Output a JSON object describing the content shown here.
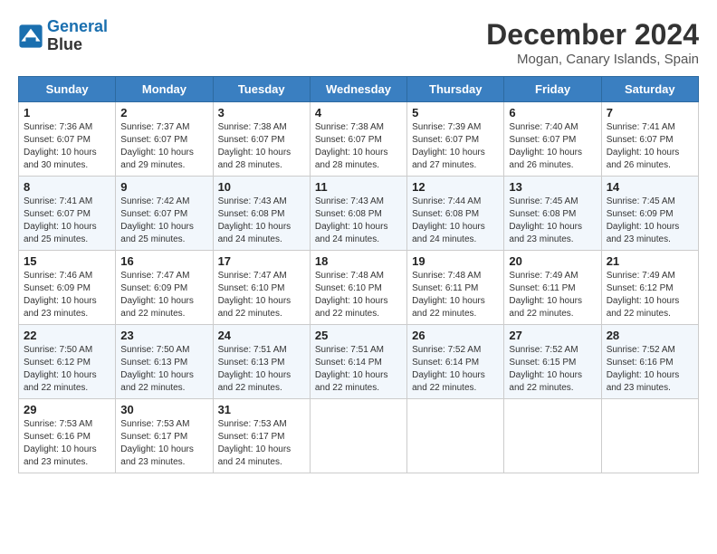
{
  "logo": {
    "line1": "General",
    "line2": "Blue"
  },
  "title": "December 2024",
  "location": "Mogan, Canary Islands, Spain",
  "weekdays": [
    "Sunday",
    "Monday",
    "Tuesday",
    "Wednesday",
    "Thursday",
    "Friday",
    "Saturday"
  ],
  "weeks": [
    [
      {
        "day": "1",
        "info": "Sunrise: 7:36 AM\nSunset: 6:07 PM\nDaylight: 10 hours\nand 30 minutes."
      },
      {
        "day": "2",
        "info": "Sunrise: 7:37 AM\nSunset: 6:07 PM\nDaylight: 10 hours\nand 29 minutes."
      },
      {
        "day": "3",
        "info": "Sunrise: 7:38 AM\nSunset: 6:07 PM\nDaylight: 10 hours\nand 28 minutes."
      },
      {
        "day": "4",
        "info": "Sunrise: 7:38 AM\nSunset: 6:07 PM\nDaylight: 10 hours\nand 28 minutes."
      },
      {
        "day": "5",
        "info": "Sunrise: 7:39 AM\nSunset: 6:07 PM\nDaylight: 10 hours\nand 27 minutes."
      },
      {
        "day": "6",
        "info": "Sunrise: 7:40 AM\nSunset: 6:07 PM\nDaylight: 10 hours\nand 26 minutes."
      },
      {
        "day": "7",
        "info": "Sunrise: 7:41 AM\nSunset: 6:07 PM\nDaylight: 10 hours\nand 26 minutes."
      }
    ],
    [
      {
        "day": "8",
        "info": "Sunrise: 7:41 AM\nSunset: 6:07 PM\nDaylight: 10 hours\nand 25 minutes."
      },
      {
        "day": "9",
        "info": "Sunrise: 7:42 AM\nSunset: 6:07 PM\nDaylight: 10 hours\nand 25 minutes."
      },
      {
        "day": "10",
        "info": "Sunrise: 7:43 AM\nSunset: 6:08 PM\nDaylight: 10 hours\nand 24 minutes."
      },
      {
        "day": "11",
        "info": "Sunrise: 7:43 AM\nSunset: 6:08 PM\nDaylight: 10 hours\nand 24 minutes."
      },
      {
        "day": "12",
        "info": "Sunrise: 7:44 AM\nSunset: 6:08 PM\nDaylight: 10 hours\nand 24 minutes."
      },
      {
        "day": "13",
        "info": "Sunrise: 7:45 AM\nSunset: 6:08 PM\nDaylight: 10 hours\nand 23 minutes."
      },
      {
        "day": "14",
        "info": "Sunrise: 7:45 AM\nSunset: 6:09 PM\nDaylight: 10 hours\nand 23 minutes."
      }
    ],
    [
      {
        "day": "15",
        "info": "Sunrise: 7:46 AM\nSunset: 6:09 PM\nDaylight: 10 hours\nand 23 minutes."
      },
      {
        "day": "16",
        "info": "Sunrise: 7:47 AM\nSunset: 6:09 PM\nDaylight: 10 hours\nand 22 minutes."
      },
      {
        "day": "17",
        "info": "Sunrise: 7:47 AM\nSunset: 6:10 PM\nDaylight: 10 hours\nand 22 minutes."
      },
      {
        "day": "18",
        "info": "Sunrise: 7:48 AM\nSunset: 6:10 PM\nDaylight: 10 hours\nand 22 minutes."
      },
      {
        "day": "19",
        "info": "Sunrise: 7:48 AM\nSunset: 6:11 PM\nDaylight: 10 hours\nand 22 minutes."
      },
      {
        "day": "20",
        "info": "Sunrise: 7:49 AM\nSunset: 6:11 PM\nDaylight: 10 hours\nand 22 minutes."
      },
      {
        "day": "21",
        "info": "Sunrise: 7:49 AM\nSunset: 6:12 PM\nDaylight: 10 hours\nand 22 minutes."
      }
    ],
    [
      {
        "day": "22",
        "info": "Sunrise: 7:50 AM\nSunset: 6:12 PM\nDaylight: 10 hours\nand 22 minutes."
      },
      {
        "day": "23",
        "info": "Sunrise: 7:50 AM\nSunset: 6:13 PM\nDaylight: 10 hours\nand 22 minutes."
      },
      {
        "day": "24",
        "info": "Sunrise: 7:51 AM\nSunset: 6:13 PM\nDaylight: 10 hours\nand 22 minutes."
      },
      {
        "day": "25",
        "info": "Sunrise: 7:51 AM\nSunset: 6:14 PM\nDaylight: 10 hours\nand 22 minutes."
      },
      {
        "day": "26",
        "info": "Sunrise: 7:52 AM\nSunset: 6:14 PM\nDaylight: 10 hours\nand 22 minutes."
      },
      {
        "day": "27",
        "info": "Sunrise: 7:52 AM\nSunset: 6:15 PM\nDaylight: 10 hours\nand 22 minutes."
      },
      {
        "day": "28",
        "info": "Sunrise: 7:52 AM\nSunset: 6:16 PM\nDaylight: 10 hours\nand 23 minutes."
      }
    ],
    [
      {
        "day": "29",
        "info": "Sunrise: 7:53 AM\nSunset: 6:16 PM\nDaylight: 10 hours\nand 23 minutes."
      },
      {
        "day": "30",
        "info": "Sunrise: 7:53 AM\nSunset: 6:17 PM\nDaylight: 10 hours\nand 23 minutes."
      },
      {
        "day": "31",
        "info": "Sunrise: 7:53 AM\nSunset: 6:17 PM\nDaylight: 10 hours\nand 24 minutes."
      },
      null,
      null,
      null,
      null
    ]
  ]
}
